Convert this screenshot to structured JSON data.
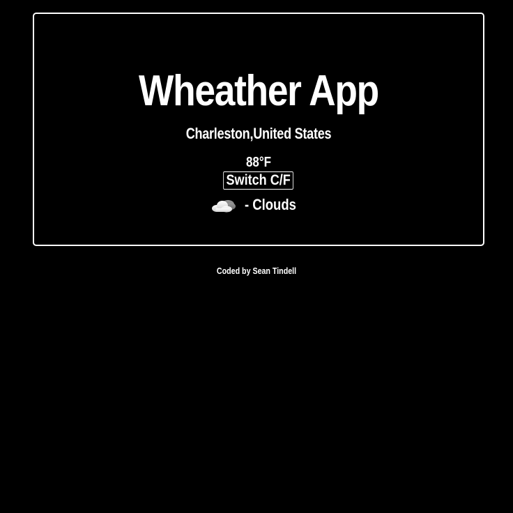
{
  "app": {
    "title": "Wheather App"
  },
  "weather": {
    "location": "Charleston,United States",
    "temperature": "88°F",
    "switch_label": "Switch C/F",
    "condition": "- Clouds",
    "condition_icon": "cloud-icon"
  },
  "footer": {
    "credit": "Coded by Sean Tindell"
  },
  "colors": {
    "background": "#000000",
    "foreground": "#ffffff"
  }
}
